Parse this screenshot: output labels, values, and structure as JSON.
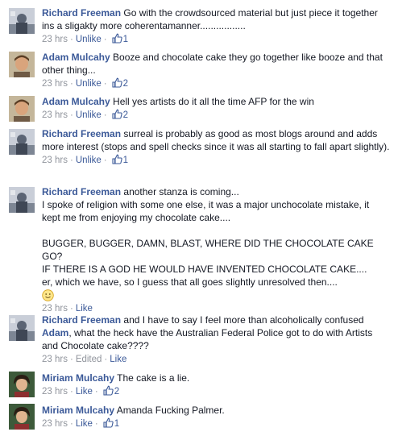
{
  "comments": [
    {
      "author": "Richard Freeman",
      "text": "Go with the crowdsourced material but just piece it together ins a sligakty more coherentamanner.................",
      "time": "23 hrs",
      "action": "Unlike",
      "likes": "1",
      "avatar": "richard"
    },
    {
      "author": "Adam Mulcahy",
      "text": "Booze and chocolate cake they go together like booze and that other thing...",
      "time": "23 hrs",
      "action": "Unlike",
      "likes": "2",
      "avatar": "adam"
    },
    {
      "author": "Adam Mulcahy",
      "text": "Hell yes artists do it all the time AFP for the win",
      "time": "23 hrs",
      "action": "Unlike",
      "likes": "2",
      "avatar": "adam"
    },
    {
      "author": "Richard Freeman",
      "text": "surreal is probably as good as most blogs around and adds more interest (stops and spell checks since it was all starting to fall apart slightly).",
      "time": "23 hrs",
      "action": "Unlike",
      "likes": "1",
      "avatar": "richard"
    },
    {
      "author": "Richard Freeman",
      "text": "another stanza is coming...\nI spoke of religion with some one else, it was a major unchocolate mistake, it kept me from enjoying my chocolate cake....",
      "text2": "BUGGER, BUGGER, DAMN, BLAST, WHERE DID THE CHOCOLATE CAKE GO?\nIF THERE IS A GOD HE WOULD HAVE INVENTED CHOCOLATE CAKE....\ner, which we have, so I guess that all goes slightly unresolved then....",
      "emoji": "smile-emoji",
      "time": "23 hrs",
      "action": "Like",
      "avatar": "richard"
    },
    {
      "author": "Richard Freeman",
      "text": "and I have to say I feel more than alcoholically confused",
      "mention": "Adam",
      "text_after": ", what the heck have the Australian Federal Police got to do with Artists and Chocolate cake????",
      "time": "23 hrs",
      "edited": "Edited",
      "action": "Like",
      "avatar": "richard"
    },
    {
      "author": "Miriam Mulcahy",
      "text": "The cake is a lie.",
      "time": "23 hrs",
      "action": "Like",
      "likes": "2",
      "avatar": "miriam"
    },
    {
      "author": "Miriam Mulcahy",
      "text": "Amanda Fucking Palmer.",
      "time": "23 hrs",
      "action": "Like",
      "likes": "1",
      "avatar": "miriam"
    }
  ],
  "icons": {
    "like": "thumbs-up-icon",
    "emoji": "smile-emoji"
  },
  "colors": {
    "link": "#3b5998",
    "meta": "#90949c",
    "text": "#141823"
  }
}
